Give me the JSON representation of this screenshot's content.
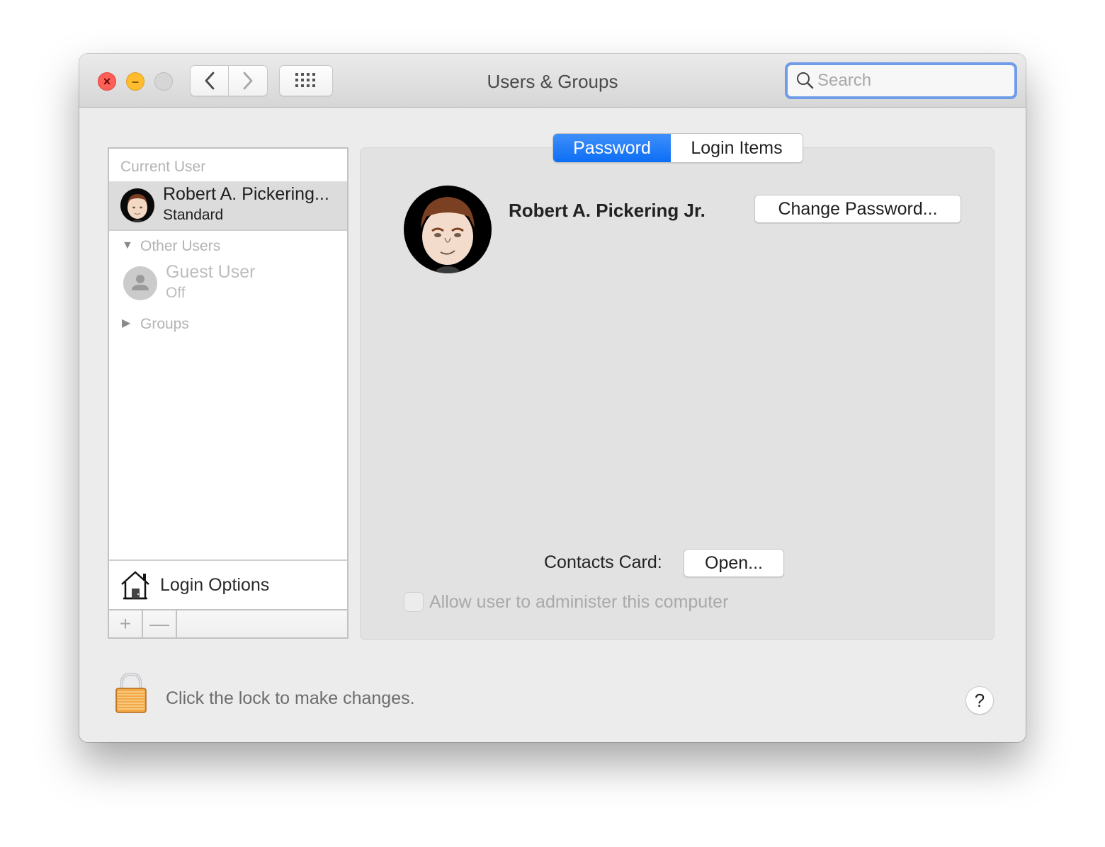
{
  "window": {
    "title": "Users & Groups",
    "controls": [
      "close",
      "minimize",
      "zoom"
    ]
  },
  "toolbar": {
    "back_icon": "chevron-left-icon",
    "forward_icon": "chevron-right-icon",
    "show_all_icon": "grid-icon",
    "search": {
      "placeholder": "Search",
      "value": ""
    }
  },
  "sidebar": {
    "current_user_header": "Current User",
    "current_user": {
      "name": "Robert A. Pickering...",
      "type": "Standard"
    },
    "other_users_header": "Other Users",
    "other_users": [
      {
        "name": "Guest User",
        "status": "Off"
      }
    ],
    "groups_label": "Groups",
    "login_options_label": "Login Options",
    "add_label": "+",
    "remove_label": "—"
  },
  "main": {
    "tabs": [
      {
        "label": "Password",
        "active": true
      },
      {
        "label": "Login Items",
        "active": false
      }
    ],
    "full_name": "Robert A. Pickering Jr.",
    "change_password_label": "Change Password...",
    "contacts_card_label": "Contacts Card:",
    "open_label": "Open...",
    "admin_checkbox": {
      "label": "Allow user to administer this computer",
      "checked": false,
      "enabled": false
    }
  },
  "footer": {
    "lock_text": "Click the lock to make changes.",
    "help_label": "?"
  },
  "colors": {
    "accent": "#0c6ef5",
    "search_focus_ring": "#6f9ce8",
    "close": "#fe5f57",
    "minimize": "#febc2e",
    "lock": "#f2a846"
  }
}
